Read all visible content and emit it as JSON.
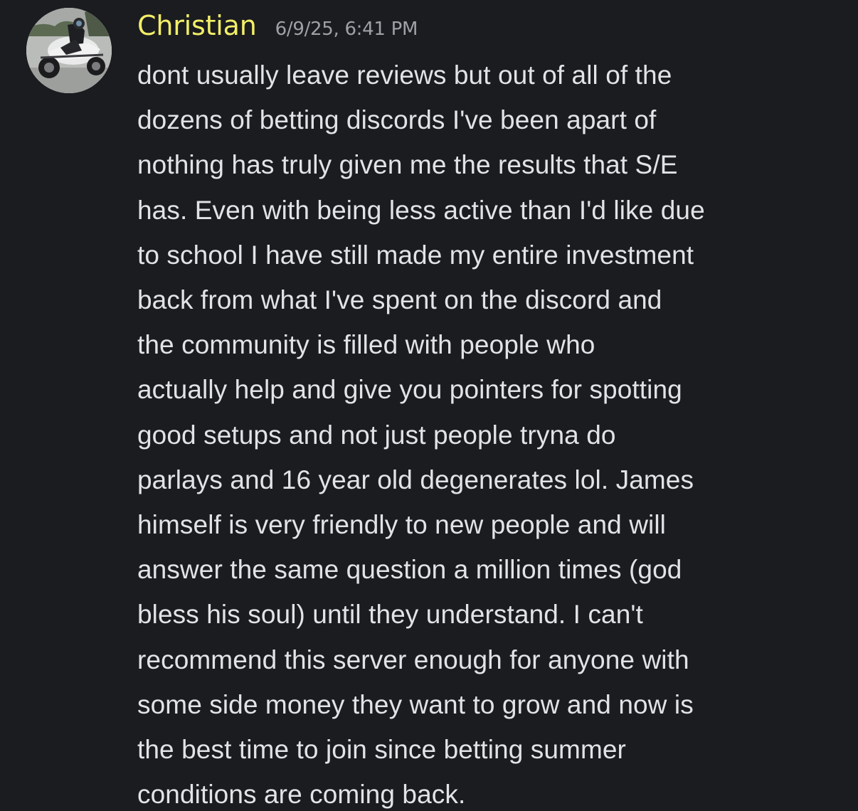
{
  "message": {
    "author": "Christian",
    "timestamp": "6/9/25, 6:41 PM",
    "avatar_icon": "avatar-motorcycle-rider",
    "author_color": "#f3ee67",
    "text_lines": [
      "dont usually leave reviews but out of all of the",
      "dozens of betting discords I've been apart of",
      "nothing has truly given me the results that S/E",
      "has. Even with being less active than I'd like due",
      "to school I have still made my entire investment",
      "back from what I've spent on the discord and",
      "the community is filled with people who",
      "actually help and give you pointers for spotting",
      "good setups and not just people tryna do",
      "parlays and 16 year old degenerates lol. James",
      "himself is very friendly to new people and will",
      "answer the same question a million times (god",
      "bless his soul) until they understand. I can't",
      "recommend this server enough for anyone with",
      "some side money they want to grow and now is",
      "the best time to join since betting summer",
      "conditions are coming back."
    ]
  }
}
